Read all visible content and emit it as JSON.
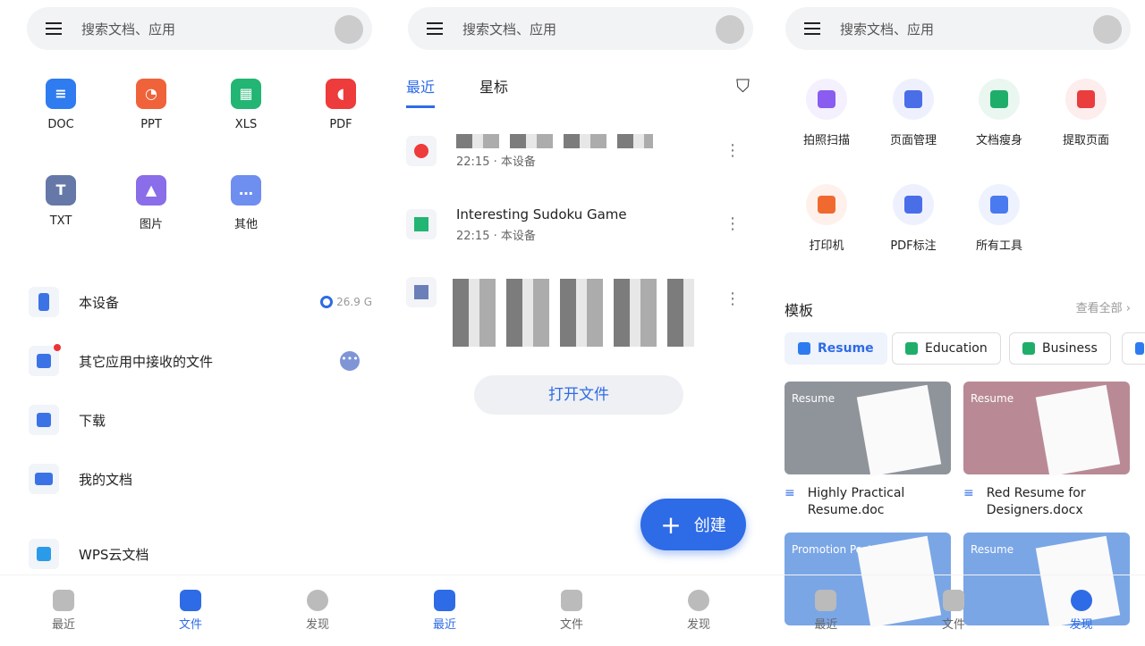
{
  "search": {
    "placeholder": "搜索文档、应用"
  },
  "nav": {
    "recent": "最近",
    "files": "文件",
    "discover": "发现"
  },
  "files_panel": {
    "types": [
      {
        "label": "DOC",
        "color": "#2f7bf0",
        "glyph": "≡"
      },
      {
        "label": "PPT",
        "color": "#f0623a",
        "glyph": "◔"
      },
      {
        "label": "XLS",
        "color": "#22b573",
        "glyph": "▦"
      },
      {
        "label": "PDF",
        "color": "#ee3b3b",
        "glyph": "◖"
      },
      {
        "label": "TXT",
        "color": "#6578a8",
        "glyph": "T"
      },
      {
        "label": "图片",
        "color": "#8a6de9",
        "glyph": "▲"
      },
      {
        "label": "其他",
        "color": "#6e8ef0",
        "glyph": "…"
      }
    ],
    "locations": [
      {
        "label": "本设备",
        "extra": "26.9 G"
      },
      {
        "label": "其它应用中接收的文件"
      },
      {
        "label": "下载"
      },
      {
        "label": "我的文档"
      },
      {
        "label": "WPS云文档"
      }
    ]
  },
  "recent_panel": {
    "tabs": [
      "最近",
      "星标"
    ],
    "files": [
      {
        "name": "",
        "meta": "22:15 · 本设备"
      },
      {
        "name": "Interesting Sudoku Game",
        "meta": "22:15 · 本设备"
      },
      {
        "name": "",
        "meta": ""
      }
    ],
    "open_file": "打开文件",
    "create": "创建"
  },
  "discover_panel": {
    "tools": [
      {
        "label": "拍照扫描",
        "color": "#8a5cf0"
      },
      {
        "label": "页面管理",
        "color": "#4a6ee8"
      },
      {
        "label": "文档瘦身",
        "color": "#1fae6a"
      },
      {
        "label": "提取页面",
        "color": "#ea3d3d"
      },
      {
        "label": "打印机",
        "color": "#f06a30"
      },
      {
        "label": "PDF标注",
        "color": "#4a6ee8"
      },
      {
        "label": "所有工具",
        "color": "#4a7af0"
      }
    ],
    "templates_title": "模板",
    "view_all": "查看全部 ›",
    "chips": [
      "Resume",
      "Education",
      "Business"
    ],
    "cards": [
      {
        "name": "Highly Practical Resume.doc",
        "thumb_title": "Resume",
        "bg": "#8f949b"
      },
      {
        "name": "Red Resume for Designers.docx",
        "thumb_title": "Resume",
        "bg": "#b98a95"
      },
      {
        "name": "",
        "thumb_title": "Promotion Poster",
        "bg": "#7aa6e6"
      },
      {
        "name": "",
        "thumb_title": "Resume",
        "bg": "#7aa6e6"
      }
    ]
  }
}
